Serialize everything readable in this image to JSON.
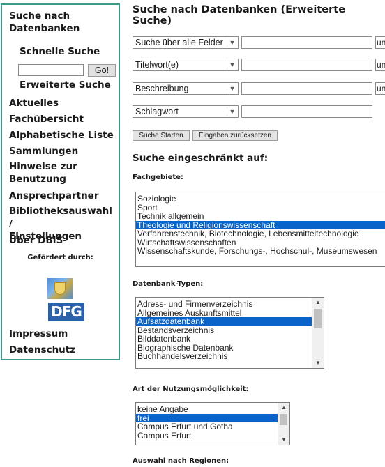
{
  "sidebar": {
    "title_line1": "Suche nach",
    "title_line2": "Datenbanken",
    "quick_search": "Schnelle Suche",
    "quick_input_value": "",
    "go_label": "Go!",
    "extended_search": "Erweiterte Suche",
    "links": [
      "Aktuelles",
      "Fachübersicht",
      "Alphabetische Liste",
      "Sammlungen",
      "Hinweise zur",
      "Benutzung",
      "Ansprechpartner",
      "Bibliotheksauswahl /",
      "Einstellungen",
      "Über DBIS"
    ],
    "funded_by": "Gefördert durch:",
    "logo_dfg": "DFG",
    "imprint": "Impressum",
    "privacy": "Datenschutz"
  },
  "main": {
    "title": "Suche nach Datenbanken (Erweiterte Suche)",
    "rows": [
      {
        "field": "Suche über alle Felder",
        "connector": "un"
      },
      {
        "field": "Titelwort(e)",
        "connector": "un"
      },
      {
        "field": "Beschreibung",
        "connector": "un"
      },
      {
        "field": "Schlagwort",
        "connector": ""
      }
    ],
    "search_button": "Suche Starten",
    "reset_button": "Eingaben zurücksetzen",
    "restricted_title": "Suche eingeschränkt auf:",
    "subjects_label": "Fachgebiete:",
    "subjects": [
      "Soziologie",
      "Sport",
      "Technik allgemein",
      "Theologie und Religionswissenschaft",
      "Verfahrenstechnik, Biotechnologie, Lebensmitteltechnologie",
      "Wirtschaftswissenschaften",
      "Wissenschaftskunde, Forschungs-, Hochschul-, Museumswesen"
    ],
    "subjects_selected": "Theologie und Religionswissenschaft",
    "types_label": "Datenbank-Typen:",
    "types": [
      "Adress- und Firmenverzeichnis",
      "Allgemeines Auskunftsmittel",
      "Aufsatzdatenbank",
      "Bestandsverzeichnis",
      "Bilddatenbank",
      "Biographische Datenbank",
      "Buchhandelsverzeichnis"
    ],
    "types_selected": "Aufsatzdatenbank",
    "access_label": "Art der Nutzungsmöglichkeit:",
    "access": [
      "keine Angabe",
      "frei",
      "Campus Erfurt und Gotha",
      "Campus Erfurt"
    ],
    "access_selected": "frei",
    "regions_label": "Auswahl nach Regionen:"
  },
  "colors": {
    "sidebar_border": "#3a9a8a",
    "selection": "#0a63c9",
    "dfg_blue": "#2a61a8"
  }
}
